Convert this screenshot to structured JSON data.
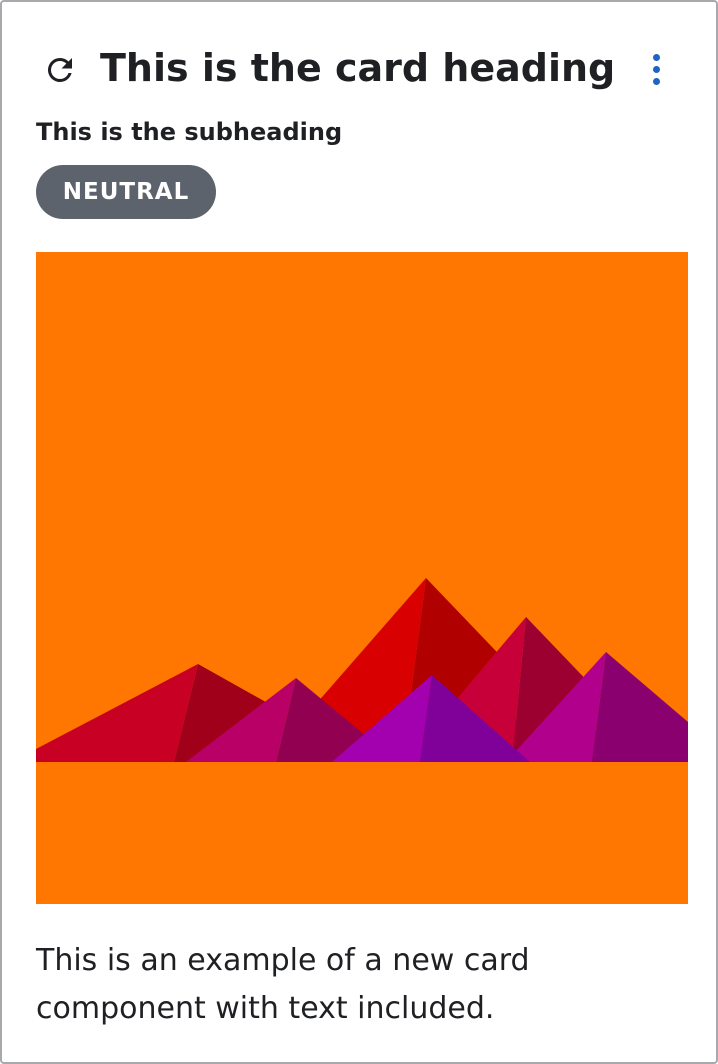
{
  "card": {
    "heading": "This is the card heading",
    "subheading": "This is the subheading",
    "badge": "NEUTRAL",
    "body_text": "This is an example of a new card component with text included.",
    "icons": {
      "refresh": "refresh-icon",
      "menu": "kebab-menu-icon"
    }
  },
  "colors": {
    "image_background": "#FF7600",
    "badge_background": "#5D636D",
    "menu_icon": "#1E63C6",
    "heading_text": "#1F2023"
  }
}
